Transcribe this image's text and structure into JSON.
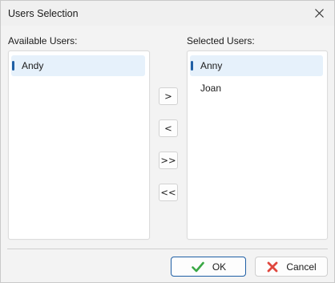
{
  "window": {
    "title": "Users Selection"
  },
  "available": {
    "label": "Available Users:",
    "items": [
      "Andy"
    ],
    "selected_index": 0
  },
  "selected": {
    "label": "Selected Users:",
    "items": [
      "Anny",
      "Joan"
    ],
    "selected_index": 0
  },
  "transfer": {
    "add_one": ">",
    "remove_one": "<",
    "add_all": ">>",
    "remove_all": "<<"
  },
  "footer": {
    "ok_label": "OK",
    "cancel_label": "Cancel"
  },
  "colors": {
    "accent": "#1f5fa5",
    "selection_bg": "#e6f1fb",
    "ok_icon": "#3aa845",
    "cancel_icon": "#e0473e"
  },
  "icons": {
    "close": "close-icon",
    "ok": "check-icon",
    "cancel": "cross-icon"
  }
}
